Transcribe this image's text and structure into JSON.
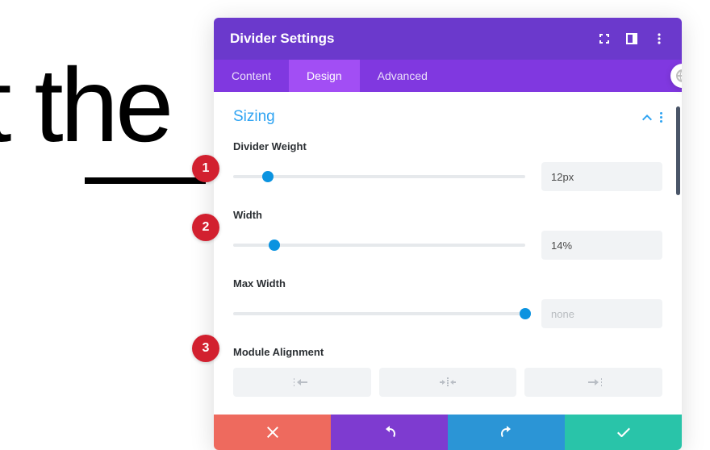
{
  "background": {
    "text": "et the"
  },
  "callouts": [
    "1",
    "2",
    "3"
  ],
  "panel": {
    "title": "Divider Settings",
    "tabs": [
      {
        "label": "Content",
        "active": false
      },
      {
        "label": "Design",
        "active": true
      },
      {
        "label": "Advanced",
        "active": false
      }
    ],
    "section": {
      "title": "Sizing",
      "fields": {
        "divider_weight": {
          "label": "Divider Weight",
          "value": "12px",
          "thumb_pct": 12
        },
        "width": {
          "label": "Width",
          "value": "14%",
          "thumb_pct": 14
        },
        "max_width": {
          "label": "Max Width",
          "value": "none",
          "thumb_pct": 100
        },
        "alignment": {
          "label": "Module Alignment"
        }
      }
    }
  }
}
